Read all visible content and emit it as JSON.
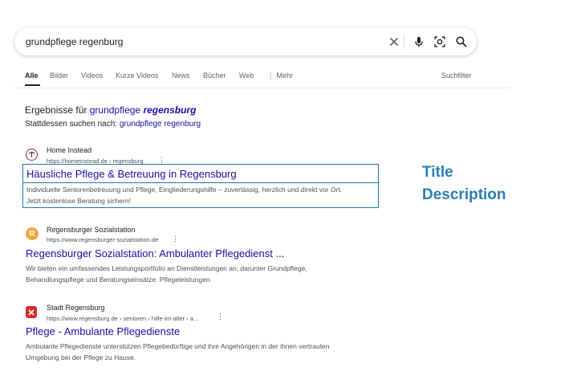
{
  "search": {
    "query": "grundpflege regenburg"
  },
  "tabs": [
    "Alle",
    "Bilder",
    "Videos",
    "Kurze Videos",
    "News",
    "Bücher",
    "Web",
    "Mehr"
  ],
  "tools_label": "Suchfilter",
  "correction": {
    "results_prefix": "Ergebnisse für ",
    "results_word1": "grundpflege",
    "results_word2": "regensburg",
    "instead_prefix": "Stattdessen suchen nach: ",
    "instead_link": "grundpflege regenburg"
  },
  "results": [
    {
      "site": "Home Instead",
      "url": "https://homeinstead.de › regensburg",
      "title": "Häusliche Pflege & Betreuung in Regensburg",
      "desc1": "Individuelle Seniorenbetreuung und Pflege, Eingliederungshilfe – zuverlässig, herzlich und direkt vor Ort.",
      "desc2": "Jetzt kostenlose Beratung sichern!"
    },
    {
      "site": "Regensburger Sozialstation",
      "url": "https://www.regensburger-sozialstation.de",
      "title": "Regensburger Sozialstation: Ambulanter Pflegedienst ...",
      "desc1": "Wir bieten ein umfassendes Leistungsportfolio an Dienstleistungen an, darunter Grundpflege,",
      "desc2": "Behandlungspflege und Beratungseinsätze. Pflegeleistungen."
    },
    {
      "site": "Stadt Regensburg",
      "url": "https://www.regensburg.de › senioren › hilfe-im-alter › a...",
      "title": "Pflege - Ambulante Pflegedienste",
      "desc1": "Ambulante Pflegedienste unterstützen Pflegebedürftige und ihre Angehörigen in der ihnen vertrauten",
      "desc2": "Umgebung bei der Pflege zu Hause."
    }
  ],
  "annotation": {
    "title_label": "Title",
    "description_label": "Description",
    "color": "#2a7fb3"
  },
  "icons": [
    "clear-icon",
    "microphone-icon",
    "lens-icon",
    "search-icon",
    "more-dots-icon",
    "home-instead-logo",
    "sozialstation-logo",
    "stadt-regensburg-crest"
  ]
}
